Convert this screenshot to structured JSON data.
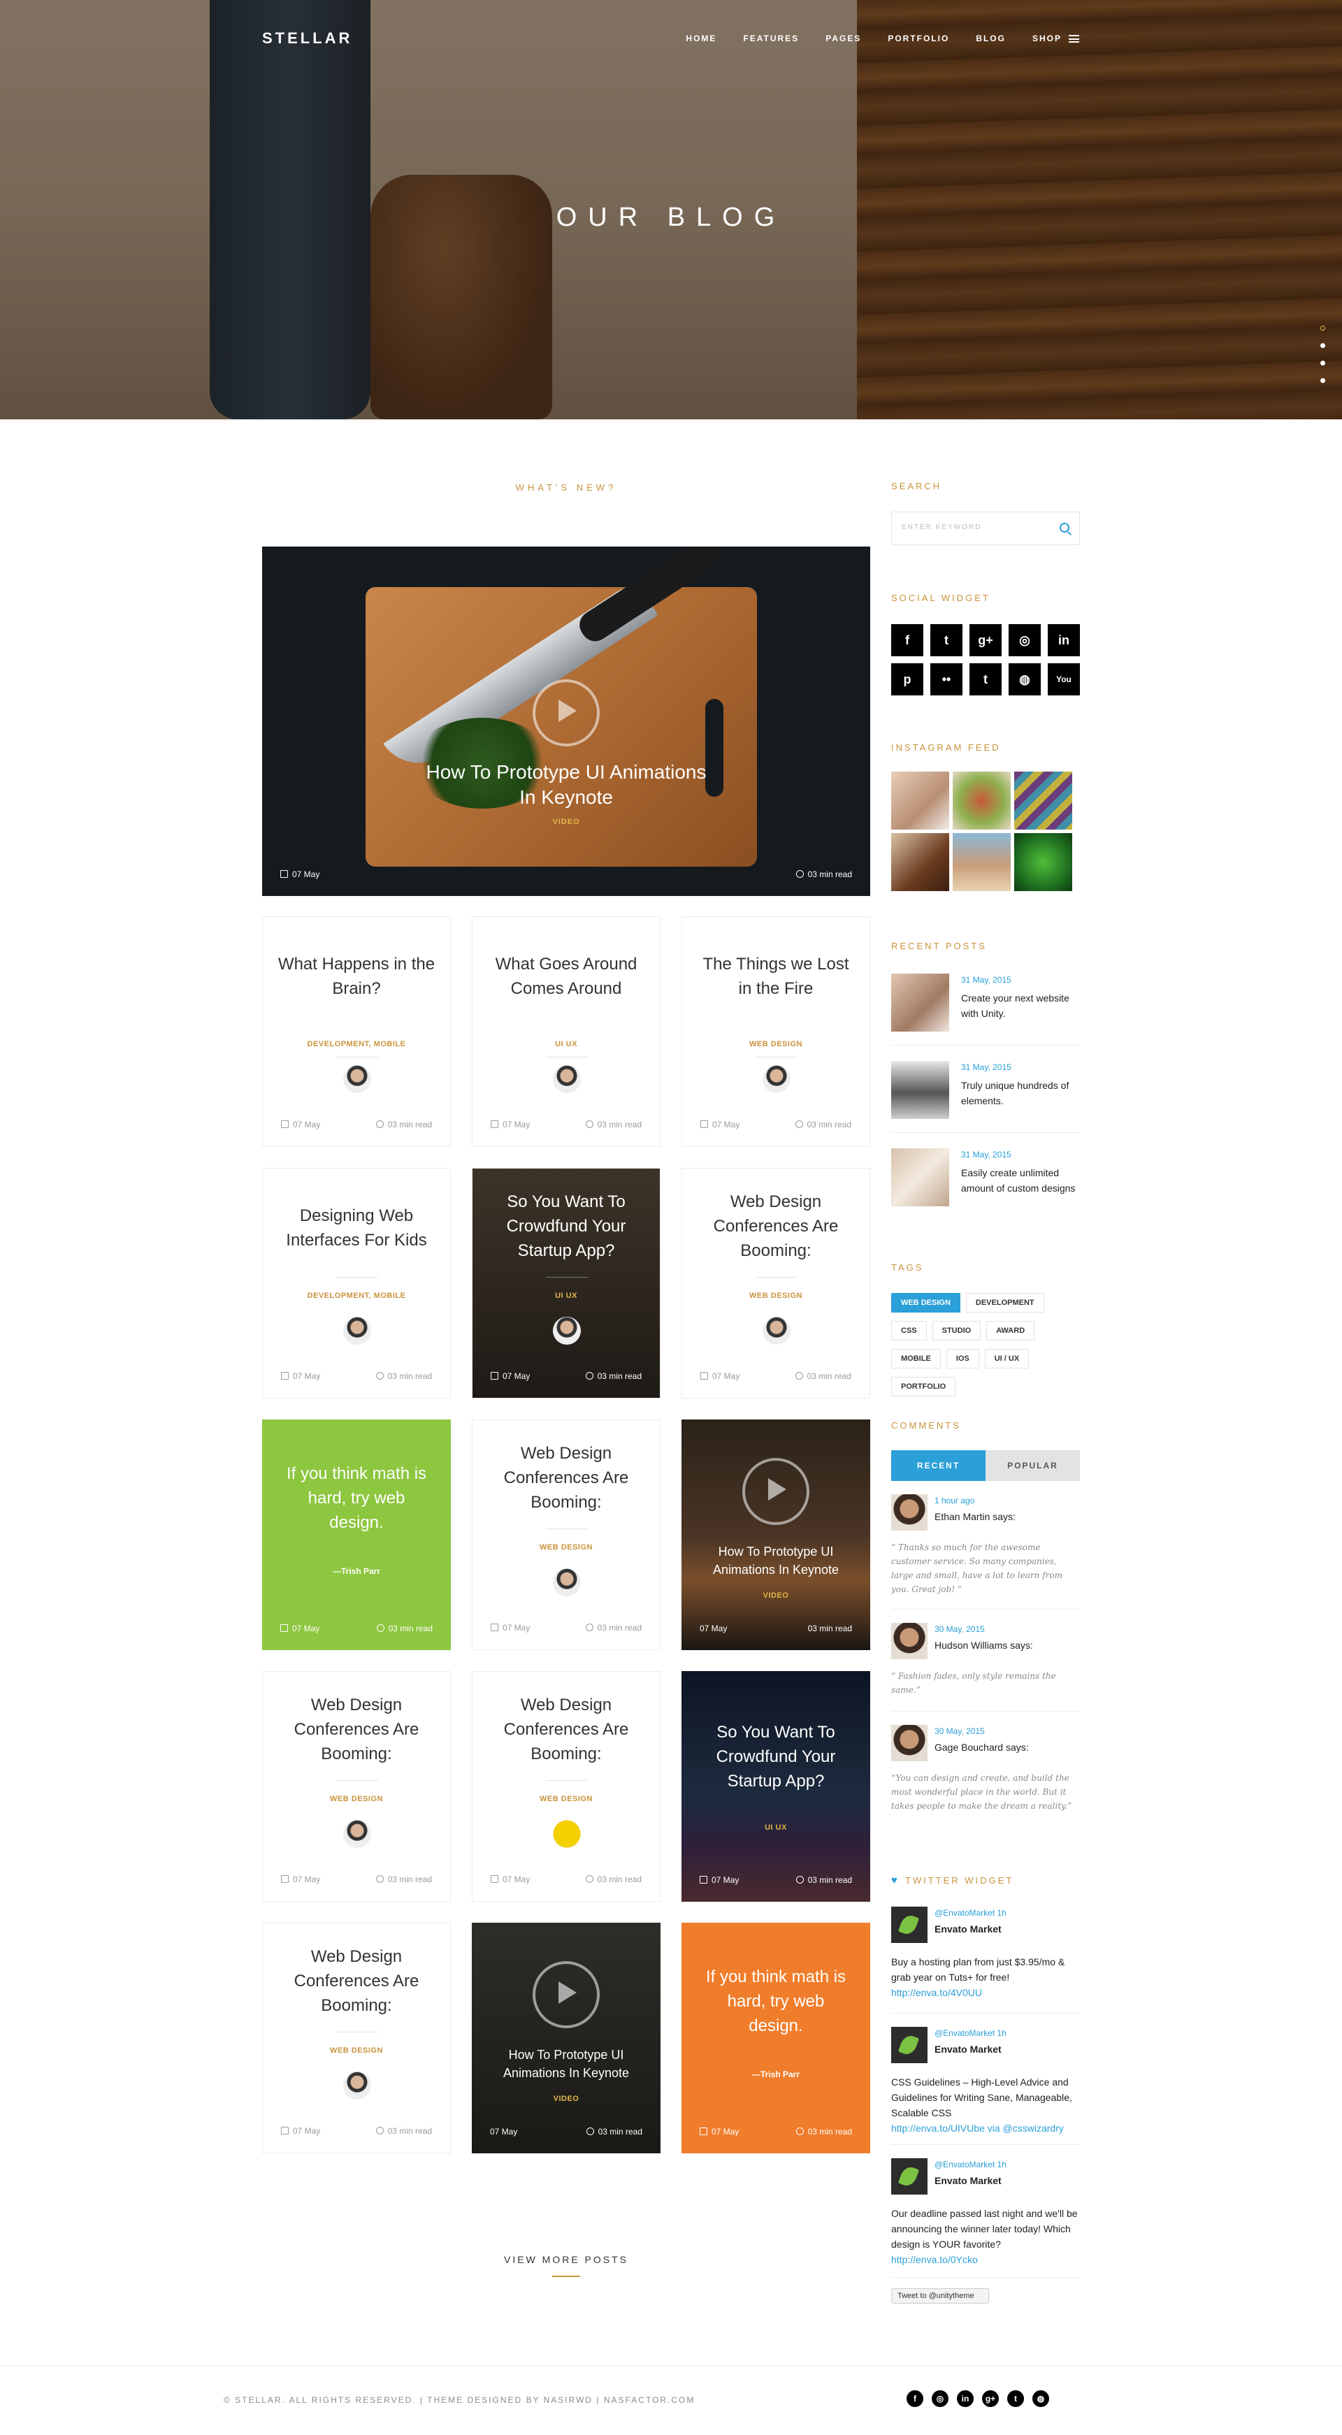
{
  "brand": "STELLAR",
  "nav": [
    "HOME",
    "FEATURES",
    "PAGES",
    "PORTFOLIO",
    "BLOG",
    "SHOP"
  ],
  "hero_title": "OUR BLOG",
  "section_title": "WHAT'S NEW?",
  "featured": {
    "title_line1": "How To Prototype UI Animations",
    "title_line2": "In Keynote",
    "tag": "VIDEO",
    "date": "07 May",
    "read": "03 min read"
  },
  "cards": [
    {
      "title": "What Happens in the Brain?",
      "tag": "DEVELOPMENT, MOBILE",
      "date": "07 May",
      "read": "03 min read"
    },
    {
      "title": "What Goes Around Comes Around",
      "tag": "UI UX",
      "date": "07 May",
      "read": "03 min read"
    },
    {
      "title": "The Things we Lost in the Fire",
      "tag": "WEB DESIGN",
      "date": "07 May",
      "read": "03 min read"
    },
    {
      "title": "Designing Web Interfaces For Kids",
      "tag": "DEVELOPMENT, MOBILE",
      "date": "07 May",
      "read": "03 min read"
    },
    {
      "title": "So You Want To Crowdfund Your Startup App?",
      "tag": "UI UX",
      "date": "07 May",
      "read": "03 min read"
    },
    {
      "title": "Web Design Conferences Are Booming:",
      "tag": "WEB DESIGN",
      "date": "07 May",
      "read": "03 min read"
    },
    {
      "title": "If you think math is hard, try web design.",
      "author": "—Trish Parr",
      "date": "07 May",
      "read": "03 min read"
    },
    {
      "title": "Web Design Conferences Are Booming:",
      "tag": "WEB DESIGN",
      "date": "07 May",
      "read": "03 min read"
    },
    {
      "title": "How To Prototype UI Animations In Keynote",
      "tag": "VIDEO",
      "date": "07 May",
      "read": "03 min read"
    },
    {
      "title": "Web Design Conferences Are Booming:",
      "tag": "WEB DESIGN",
      "date": "07 May",
      "read": "03 min read"
    },
    {
      "title": "Web Design Conferences Are Booming:",
      "tag": "WEB DESIGN",
      "date": "07 May",
      "read": "03 min read"
    },
    {
      "title": "So You Want To Crowdfund Your Startup App?",
      "tag": "UI UX",
      "date": "07 May",
      "read": "03 min read"
    },
    {
      "title": "Web Design Conferences Are Booming:",
      "tag": "WEB DESIGN",
      "date": "07 May",
      "read": "03 min read"
    },
    {
      "title": "How To Prototype UI Animations In Keynote",
      "tag": "VIDEO",
      "date": "07 May",
      "read": "03 min read"
    },
    {
      "title": "If you think math is hard, try web design.",
      "author": "—Trish Parr",
      "date": "07 May",
      "read": "03 min read"
    }
  ],
  "view_more": "VIEW MORE POSTS",
  "sidebar": {
    "search_title": "SEARCH",
    "search_placeholder": "ENTER KEYWORD",
    "social_title": "SOCIAL WIDGET",
    "social_icons": [
      "f",
      "t",
      "g+",
      "◎",
      "in",
      "p",
      "••",
      "t",
      "◍",
      "You"
    ],
    "instagram_title": "INSTAGRAM FEED",
    "recent_title": "RECENT POSTS",
    "recent_posts": [
      {
        "date": "31 May, 2015",
        "title": "Create your next website with Unity."
      },
      {
        "date": "31 May, 2015",
        "title": "Truly unique hundreds of elements."
      },
      {
        "date": "31 May, 2015",
        "title": "Easily create unlimited amount of custom designs"
      }
    ],
    "tags_title": "TAGS",
    "tags": [
      "WEB DESIGN",
      "DEVELOPMENT",
      "CSS",
      "STUDIO",
      "AWARD",
      "MOBILE",
      "IOS",
      "UI / UX",
      "PORTFOLIO"
    ],
    "comments_title": "COMMENTS",
    "comment_tabs": [
      "RECENT",
      "POPULAR"
    ],
    "comments": [
      {
        "date": "1 hour ago",
        "name": "Ethan Martin says:",
        "text": "“ Thanks so much for the awesome customer service. So many companies, large and small, have a lot to learn from you. Great job! ”"
      },
      {
        "date": "30 May, 2015",
        "name": "Hudson Williams says:",
        "text": "“ Fashion fades, only style remains the same.”"
      },
      {
        "date": "30 May, 2015",
        "name": "Gage Bouchard says:",
        "text": "“You can design and create, and build the most wonderful place in the world. But it takes people to make the dream a reality.”"
      }
    ],
    "twitter_title": "TWITTER WIDGET",
    "tweets": [
      {
        "handle": "@EnvatoMarket  1h",
        "name": "Envato Market",
        "text": "Buy a hosting plan from just $3.95/mo & grab year on Tuts+ for free!",
        "link": "http://enva.to/4V0UU",
        "via": ""
      },
      {
        "handle": "@EnvatoMarket  1h",
        "name": "Envato Market",
        "text": "CSS Guidelines – High-Level Advice and Guidelines for Writing Sane, Manageable, Scalable CSS",
        "link": "http://enva.to/UIVUbe",
        "via": "via @csswizardry"
      },
      {
        "handle": "@EnvatoMarket  1h",
        "name": "Envato Market",
        "text": "Our deadline passed last night and we'll be announcing the winner later today! Which design is YOUR favorite?",
        "link": "http://enva.to/0Ycko",
        "via": ""
      }
    ],
    "tweet_button": "Tweet to @unitytheme"
  },
  "footer": {
    "copyright": "© STELLAR. ALL RIGHTS RESERVED.   |   THEME DESIGNED BY NASIRWD | NASFACTOR.COM",
    "social_icons": [
      "f",
      "◎",
      "in",
      "g+",
      "t",
      "◍"
    ]
  },
  "colors": {
    "accent": "#c9933c",
    "link": "#2a9fd8",
    "green": "#8dc63f",
    "orange": "#f07d2b"
  }
}
